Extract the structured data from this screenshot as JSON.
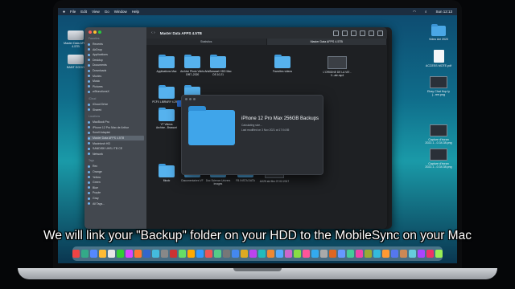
{
  "menubar": {
    "apple": "",
    "items": [
      "Finder",
      "File",
      "Edit",
      "View",
      "Go",
      "Window",
      "Help"
    ],
    "clock": "Sun 12:13"
  },
  "desktop_left": [
    {
      "label": "Master Data AFPS 4.5TB",
      "icon": "external-drive-icon"
    },
    {
      "label": "BANT GOOO",
      "icon": "external-drive-icon"
    }
  ],
  "desktop_right": [
    {
      "label": "Video Anl 2020",
      "icon": "folder-icon"
    },
    {
      "label": "ACCESS MOTE.pdf",
      "icon": "document-icon"
    },
    {
      "label": "Ebay Chat Hop ly j...ree.png",
      "icon": "screenshot-icon"
    },
    {
      "label": "Capture d'écran 2022-1...0.34.38.png",
      "icon": "screenshot-icon"
    },
    {
      "label": "Capture d'écran 2022-1...0.34.38.png",
      "icon": "screenshot-icon"
    }
  ],
  "finder": {
    "title": "Master Data AFPS 4.5TB",
    "tabs": [
      "Statistics",
      "Master Data AFPS 4.5TB"
    ],
    "sidebar": {
      "sections": [
        {
          "heading": "Favorites",
          "items": [
            "Recents",
            "AirDrop",
            "Applications",
            "Desktop",
            "Documents",
            "Downloads",
            "Movies",
            "Music",
            "Pictures",
            "w3functionsX"
          ]
        },
        {
          "heading": "iCloud",
          "items": [
            "iCloud Drive",
            "Shared"
          ]
        },
        {
          "heading": "Locations",
          "items": [
            "MacBook Pro",
            "iPhone 12 Pro Max de Arthur",
            "Scroll Adaptat",
            "Master Data AFPS 4.5TB",
            "Macintosh HD",
            "SANDISK UHS-I TB CE",
            "Network"
          ]
        },
        {
          "heading": "Tags",
          "items": [
            "Red",
            "Orange",
            "Yellow",
            "Green",
            "Blue",
            "Purple",
            "Gray",
            "All Tags..."
          ]
        }
      ],
      "selected": "Master Data AFPS 4.5TB"
    },
    "items": [
      {
        "label": "Applications Mac",
        "kind": "folder"
      },
      {
        "label": "Archive Photo Vidéo 1997–2020",
        "kind": "folder"
      },
      {
        "label": "ArtsBrassart HDD Mac OS 10.21",
        "kind": "folder"
      },
      {
        "label": "Favorites videos",
        "kind": "folder"
      },
      {
        "label": "L'ORIGINE DE LA VIE - V...ale.mp4",
        "kind": "thumb"
      },
      {
        "label": "PCFX LIBRARY 4.29.21",
        "kind": "folder"
      },
      {
        "label": "iPhone 12 Pro Max 25...Backups",
        "kind": "folder",
        "selected": true
      },
      {
        "label": "YT Videos Archive...Brassart",
        "kind": "folder"
      },
      {
        "label": "Music",
        "kind": "folder"
      },
      {
        "label": "Documentaires VF",
        "kind": "folder"
      },
      {
        "label": "Doc Science Univers images",
        "kind": "folder"
      },
      {
        "label": "FB INSTA DATA",
        "kind": "folder"
      },
      {
        "label": "AX25 ski film 07.02.2017",
        "kind": "thumb"
      }
    ]
  },
  "info_popup": {
    "name": "iPhone 12 Pro Max 256GB Backups",
    "line1": "Calculating size...",
    "line2": "Last modified on 3 Nov 2021 at 17:04:55"
  },
  "caption": "We will link your \"Backup\" folder on your HDD to the MobileSync on your Mac",
  "dock_colors": [
    "#e44",
    "#3a8",
    "#58f",
    "#fb3",
    "#e6e6e6",
    "#3c3",
    "#d4f",
    "#f73",
    "#36c",
    "#4bd",
    "#888",
    "#c33",
    "#6d6",
    "#fa0",
    "#39f",
    "#e55",
    "#5c8",
    "#777",
    "#48e",
    "#da2",
    "#b4e",
    "#2bb",
    "#e83",
    "#5af",
    "#c6c",
    "#8d4",
    "#f59",
    "#3ae",
    "#aaa",
    "#d62",
    "#69f",
    "#4c9",
    "#e4a",
    "#9a3",
    "#3bd",
    "#f93",
    "#57e",
    "#c85",
    "#6cd",
    "#a4f",
    "#e36",
    "#9e5"
  ]
}
